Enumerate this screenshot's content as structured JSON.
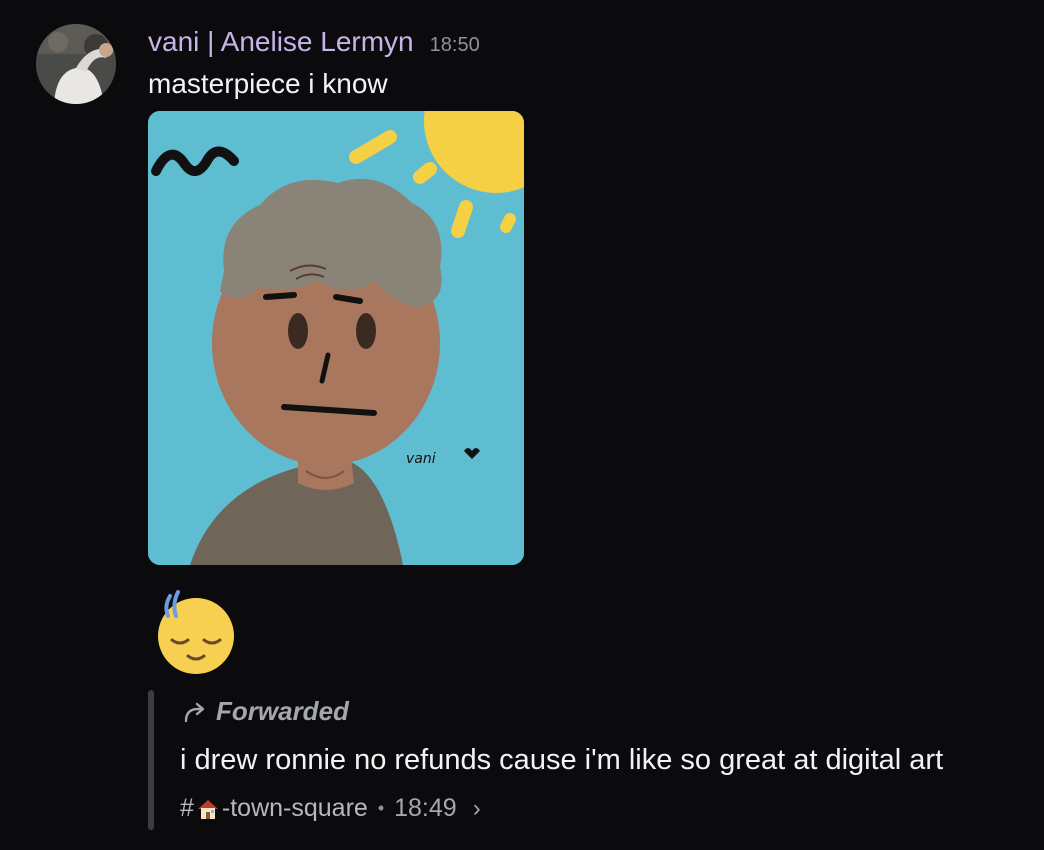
{
  "message": {
    "author": "vani | Anelise Lermyn",
    "timestamp": "18:50",
    "content": "masterpiece i know",
    "attachment": {
      "type": "image",
      "signature": "vani"
    },
    "reaction_emoji": "sleepy/sweat face"
  },
  "forwarded": {
    "label": "Forwarded",
    "content": "i drew ronnie no refunds cause i'm like so great at digital art",
    "channel_prefix": "#",
    "channel_emoji": "house",
    "channel_name": "-town-square",
    "separator": "•",
    "time": "18:49",
    "chevron": "›"
  },
  "colors": {
    "background": "#0b0b0d",
    "username": "#c8b4e8",
    "text": "#f2f3f5",
    "muted": "#a4a7ad"
  }
}
